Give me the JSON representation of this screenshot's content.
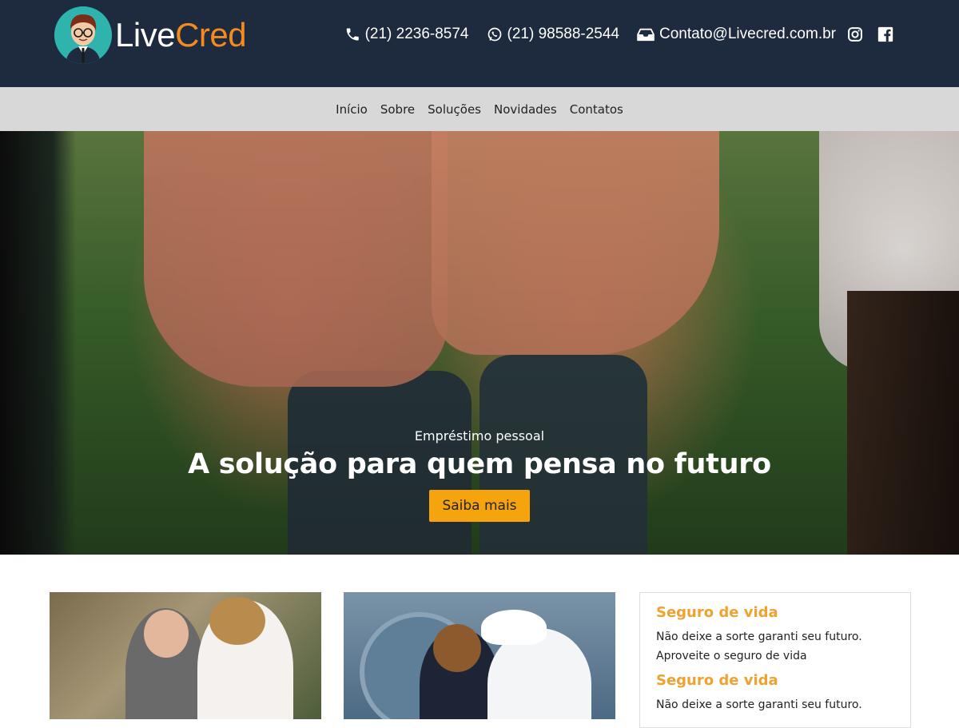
{
  "header": {
    "logo_text_white": "Live",
    "logo_text_orange": "Cred",
    "phone_icon": "phone-icon",
    "phone": "(21) 2236-8574",
    "whatsapp_icon": "whatsapp-icon",
    "whatsapp": "(21) 98588-2544",
    "email_icon": "inbox-icon",
    "email": "Contato@Livecred.com.br",
    "social": [
      "instagram-icon",
      "facebook-icon"
    ],
    "bg_color": "#1e2a3d",
    "accent": "#f38b1f"
  },
  "nav": {
    "items": [
      {
        "label": "Início"
      },
      {
        "label": "Sobre"
      },
      {
        "label": "Soluções"
      },
      {
        "label": "Novidades"
      },
      {
        "label": "Contatos"
      }
    ]
  },
  "hero": {
    "subtitle": "Empréstimo pessoal",
    "title": "A solução para quem pensa no futuro",
    "button": "Saiba mais",
    "button_color": "#f5a40e"
  },
  "sidebar": {
    "blocks": [
      {
        "title": "Seguro de vida",
        "line1": "Não deixe a sorte garanti seu futuro.",
        "line2": "Aproveite o seguro de vida"
      },
      {
        "title": "Seguro de vida",
        "line1": "Não deixe a sorte garanti seu futuro.",
        "line2": ""
      }
    ],
    "title_color": "#f0a22e"
  }
}
